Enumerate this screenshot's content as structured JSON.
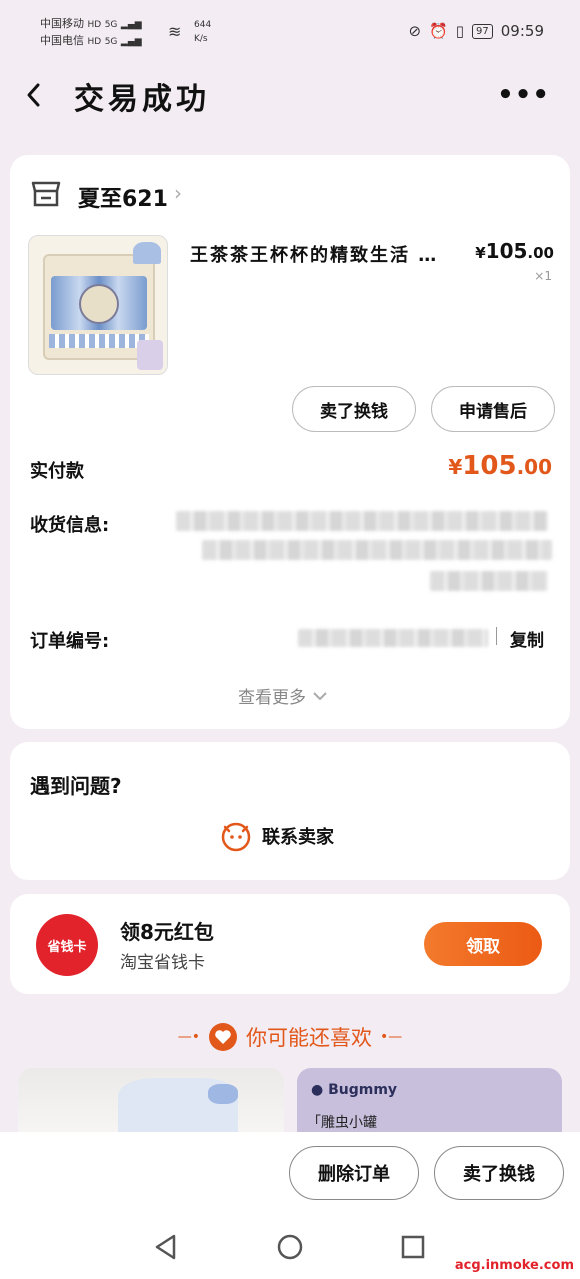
{
  "status_bar": {
    "carrier1": "中国移动",
    "carrier2": "中国电信",
    "hd": "HD",
    "net1": "5G",
    "net2": "5G",
    "speed": "644",
    "speed_unit": "K/s",
    "battery": "97",
    "time": "09:59"
  },
  "header": {
    "title": "交易成功"
  },
  "order": {
    "shop_name": "夏至621",
    "item_title": "王茶茶王杯杯的精致生活 …",
    "price_symbol": "¥",
    "price_int": "105",
    "price_dec": ".00",
    "quantity": "×1",
    "btn_resell": "卖了换钱",
    "btn_aftersale": "申请售后",
    "paid_label": "实付款",
    "paid_symbol": "¥",
    "paid_int": "105",
    "paid_dec": ".00",
    "address_label": "收货信息:",
    "order_no_label": "订单编号:",
    "copy_label": "复制",
    "view_more": "查看更多"
  },
  "help": {
    "title": "遇到问题?",
    "contact": "联系卖家"
  },
  "promo": {
    "badge": "省钱卡",
    "title": "领8元红包",
    "subtitle": "淘宝省钱卡",
    "button": "领取"
  },
  "recommend": {
    "heading": "你可能还喜欢",
    "card2_brand": "Bugmmy",
    "card2_text": "「雕虫小罐"
  },
  "bottom_bar": {
    "delete": "删除订单",
    "resell": "卖了换钱"
  },
  "watermark": "acg.inmoke.com",
  "colors": {
    "accent": "#e2581b",
    "promo_red": "#e2232c",
    "page_bg": "#f3edf3"
  }
}
